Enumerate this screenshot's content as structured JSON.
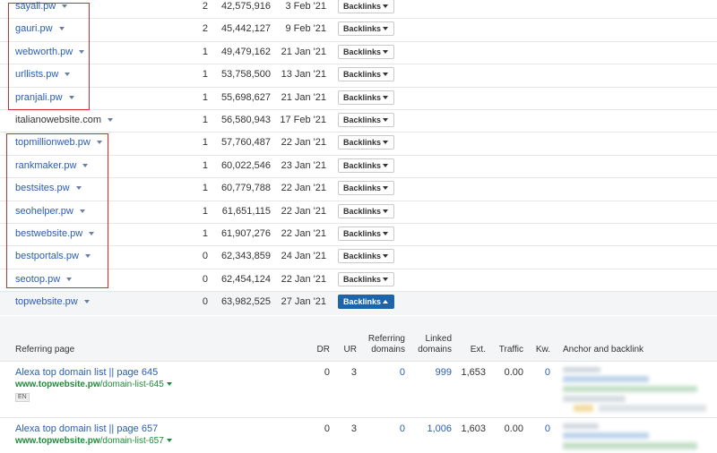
{
  "domains": [
    {
      "name": "sayali.pw",
      "linked": true,
      "count": "2",
      "rank": "42,575,916",
      "date": "3 Feb '21",
      "button": "Backlinks"
    },
    {
      "name": "gauri.pw",
      "linked": true,
      "count": "2",
      "rank": "45,442,127",
      "date": "9 Feb '21",
      "button": "Backlinks"
    },
    {
      "name": "webworth.pw",
      "linked": true,
      "count": "1",
      "rank": "49,479,162",
      "date": "21 Jan '21",
      "button": "Backlinks"
    },
    {
      "name": "urllists.pw",
      "linked": true,
      "count": "1",
      "rank": "53,758,500",
      "date": "13 Jan '21",
      "button": "Backlinks"
    },
    {
      "name": "pranjali.pw",
      "linked": true,
      "count": "1",
      "rank": "55,698,627",
      "date": "21 Jan '21",
      "button": "Backlinks"
    },
    {
      "name": "italianowebsite.com",
      "linked": false,
      "count": "1",
      "rank": "56,580,943",
      "date": "17 Feb '21",
      "button": "Backlinks"
    },
    {
      "name": "topmillionweb.pw",
      "linked": true,
      "count": "1",
      "rank": "57,760,487",
      "date": "22 Jan '21",
      "button": "Backlinks"
    },
    {
      "name": "rankmaker.pw",
      "linked": true,
      "count": "1",
      "rank": "60,022,546",
      "date": "23 Jan '21",
      "button": "Backlinks"
    },
    {
      "name": "bestsites.pw",
      "linked": true,
      "count": "1",
      "rank": "60,779,788",
      "date": "22 Jan '21",
      "button": "Backlinks"
    },
    {
      "name": "seohelper.pw",
      "linked": true,
      "count": "1",
      "rank": "61,651,115",
      "date": "22 Jan '21",
      "button": "Backlinks"
    },
    {
      "name": "bestwebsite.pw",
      "linked": true,
      "count": "1",
      "rank": "61,907,276",
      "date": "22 Jan '21",
      "button": "Backlinks"
    },
    {
      "name": "bestportals.pw",
      "linked": true,
      "count": "0",
      "rank": "62,343,859",
      "date": "24 Jan '21",
      "button": "Backlinks"
    },
    {
      "name": "seotop.pw",
      "linked": true,
      "count": "0",
      "rank": "62,454,124",
      "date": "22 Jan '21",
      "button": "Backlinks"
    },
    {
      "name": "topwebsite.pw",
      "linked": true,
      "count": "0",
      "rank": "63,982,525",
      "date": "27 Jan '21",
      "button": "Backlinks",
      "expanded": true
    }
  ],
  "backlinks_panel": {
    "headers": {
      "referring_page": "Referring page",
      "dr": "DR",
      "ur": "UR",
      "referring_domains_1": "Referring",
      "referring_domains_2": "domains",
      "linked_domains_1": "Linked",
      "linked_domains_2": "domains",
      "ext": "Ext.",
      "traffic": "Traffic",
      "kw": "Kw.",
      "anchor": "Anchor and backlink"
    },
    "rows": [
      {
        "title": "Alexa top domain list || page 645",
        "url_domain": "www.topwebsite.pw",
        "url_path": "/domain-list-645",
        "lang": "EN",
        "dr": "0",
        "ur": "3",
        "ref_domains": "0",
        "linked_domains": "999",
        "ext": "1,653",
        "traffic": "0.00",
        "kw": "0"
      },
      {
        "title": "Alexa top domain list || page 657",
        "url_domain": "www.topwebsite.pw",
        "url_path": "/domain-list-657",
        "dr": "0",
        "ur": "3",
        "ref_domains": "0",
        "linked_domains": "1,006",
        "ext": "1,603",
        "traffic": "0.00",
        "kw": "0"
      }
    ]
  },
  "colors": {
    "link": "#2a5db0",
    "url_green": "#1f8a3b",
    "highlight_box": "#d62a2a",
    "active_button": "#1d64a8"
  }
}
